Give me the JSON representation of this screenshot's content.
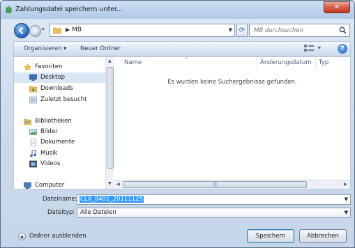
{
  "window": {
    "title": "Zahlungsdatei speichern unter..."
  },
  "address": {
    "crumb": "MB"
  },
  "search": {
    "placeholder": "MB durchsuchen"
  },
  "toolbar": {
    "organize": "Organisieren ▾",
    "new_folder": "Neuer Ordner"
  },
  "nav": {
    "items": [
      {
        "label": "Favoriten",
        "icon": "star-icon"
      },
      {
        "label": "Desktop",
        "icon": "desktop-icon",
        "selected": true
      },
      {
        "label": "Downloads",
        "icon": "downloads-folder-icon"
      },
      {
        "label": "Zuletzt besucht",
        "icon": "recent-places-icon"
      },
      {
        "label": "Bibliotheken",
        "icon": "libraries-icon"
      },
      {
        "label": "Bilder",
        "icon": "pictures-icon"
      },
      {
        "label": "Dokumente",
        "icon": "documents-icon"
      },
      {
        "label": "Musik",
        "icon": "music-icon"
      },
      {
        "label": "Videos",
        "icon": "videos-icon"
      },
      {
        "label": "Computer",
        "icon": "computer-icon"
      }
    ]
  },
  "columns": {
    "name": "Name",
    "modified": "Änderungsdatum",
    "type": "Typ"
  },
  "empty_message": "Es wurden keine Suchergebnisse gefunden.",
  "filename": {
    "label": "Dateiname:",
    "value": "CLX_8401_20111125"
  },
  "filetype": {
    "label": "Dateityp:",
    "value": "Alle Dateien"
  },
  "footer": {
    "hide_folders": "Ordner ausblenden",
    "save": "Speichern",
    "cancel": "Abbrechen"
  },
  "colors": {
    "accent": "#3399ff",
    "close": "#c1391d",
    "title_bar": "#bcd1ec"
  }
}
